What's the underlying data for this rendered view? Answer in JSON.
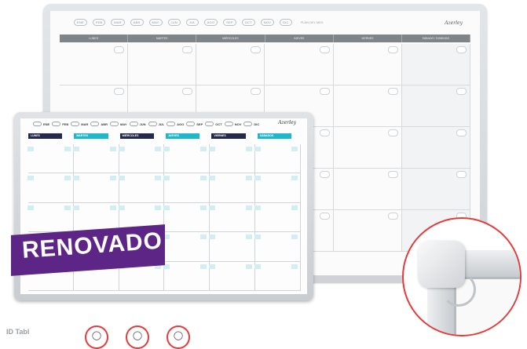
{
  "back_board": {
    "months": [
      "ENE",
      "FEB",
      "MAR",
      "ABR",
      "MAY",
      "JUN",
      "JUL",
      "AGO",
      "SEP",
      "OCT",
      "NOV",
      "DIC"
    ],
    "month_label": "PLAN DEL MES",
    "brand": "Azerley",
    "days": [
      "LUNES",
      "MARTES",
      "MIÉRCOLES",
      "JUEVES",
      "VIERNES",
      "SÁBADO / DOMINGO"
    ]
  },
  "front_board": {
    "months": [
      "ENE",
      "FEB",
      "MAR",
      "ABR",
      "MAY",
      "JUN",
      "JUL",
      "AGO",
      "SEP",
      "OCT",
      "NOV",
      "DIC"
    ],
    "brand": "Azerley",
    "days": [
      {
        "label": "LUNES",
        "style": "dark"
      },
      {
        "label": "MARTES",
        "style": "cyan"
      },
      {
        "label": "MIÉRCOLES",
        "style": "dark"
      },
      {
        "label": "JUEVES",
        "style": "cyan"
      },
      {
        "label": "VIERNES",
        "style": "dark"
      },
      {
        "label": "SÁBADOS",
        "style": "cyan"
      }
    ]
  },
  "banner": {
    "label": "RENOVADO",
    "color": "#5d2585"
  },
  "bottom": {
    "text": "ID Tabl",
    "icons": [
      "feature-icon-1",
      "feature-icon-2",
      "feature-icon-3"
    ]
  },
  "colors": {
    "accent_red": "#e53a3a",
    "dark_navy": "#232a4b",
    "cyan": "#1fb8cb"
  }
}
